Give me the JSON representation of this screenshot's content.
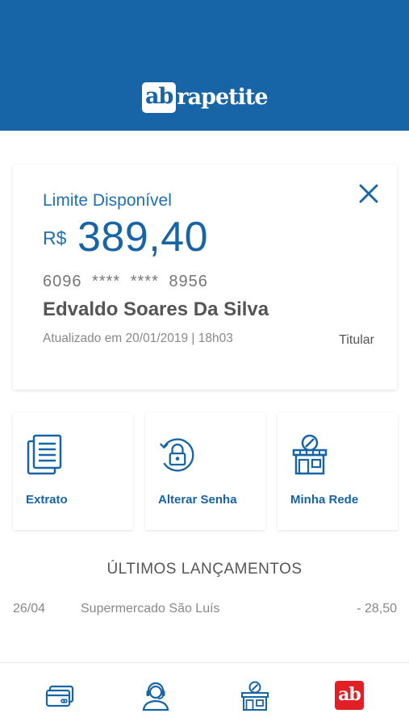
{
  "header": {
    "logo_mark": "ab",
    "logo_text": "rapetite",
    "background_color": "#1764a6"
  },
  "card": {
    "limit_label": "Limite Disponível",
    "currency": "R$",
    "amount": "389,40",
    "card_number": "6096 **** **** 8956",
    "holder_name": "Edvaldo Soares Da Silva",
    "updated_text": "Atualizado em 20/01/2019 | 18h03",
    "role": "Titular",
    "close_icon": "close-icon"
  },
  "actions": [
    {
      "label": "Extrato",
      "icon": "document-icon"
    },
    {
      "label": "Alterar Senha",
      "icon": "lock-icon"
    },
    {
      "label": "Minha Rede",
      "icon": "store-icon"
    }
  ],
  "transactions": {
    "title": "ÚLTIMOS LANÇAMENTOS",
    "items": [
      {
        "date": "26/04",
        "description": "Supermercado São Luís",
        "value": "- 28,50"
      }
    ]
  },
  "bottom_nav": {
    "items": [
      {
        "icon": "cards-icon"
      },
      {
        "icon": "support-agent-icon"
      },
      {
        "icon": "store-icon"
      },
      {
        "icon": "ab-logo-icon",
        "text": "ab",
        "color": "#e31f26"
      }
    ]
  },
  "colors": {
    "accent": "#1764a6",
    "brand_red": "#e31f26"
  }
}
